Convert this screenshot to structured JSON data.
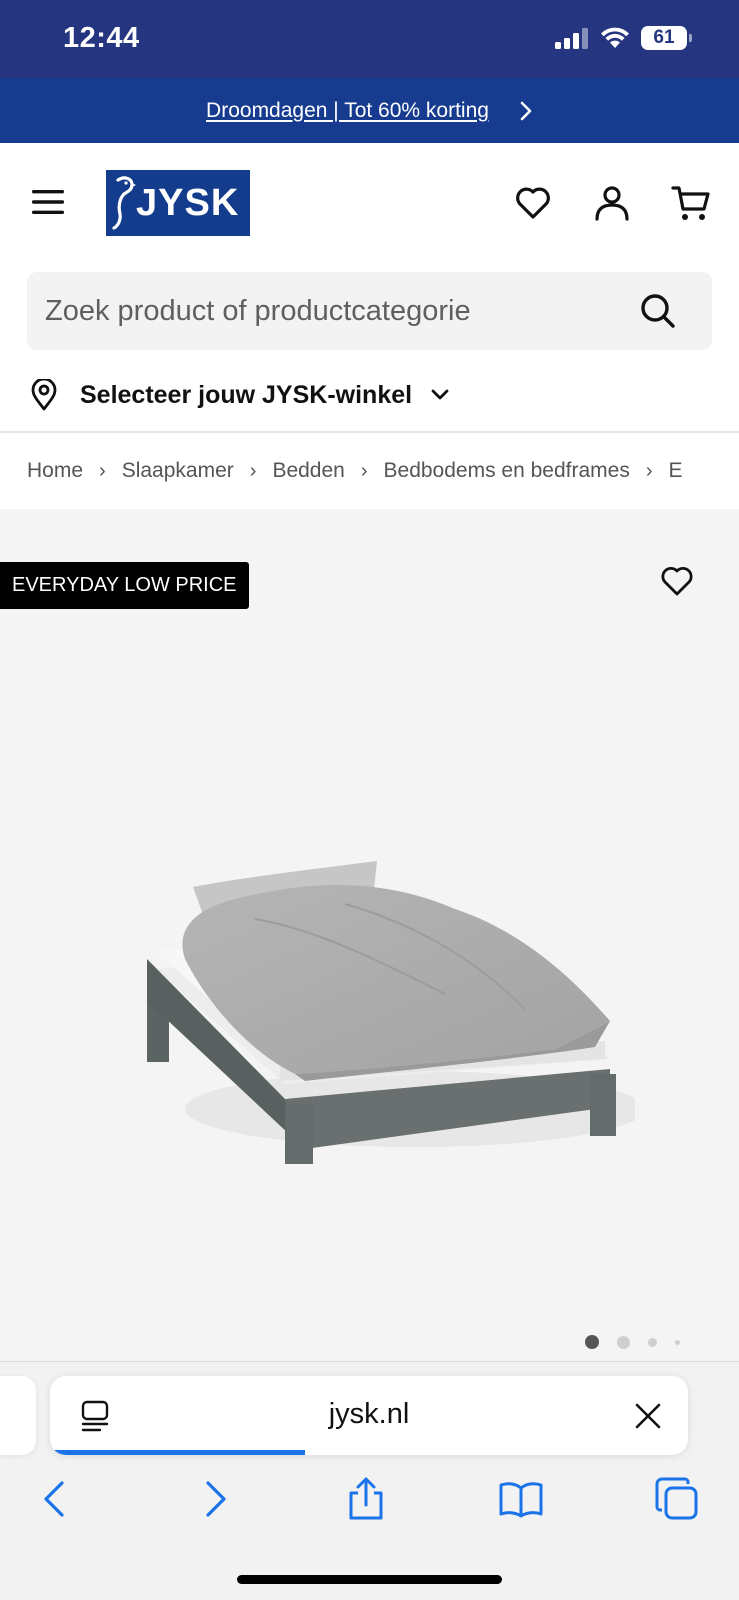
{
  "status_bar": {
    "time": "12:44",
    "battery": "61"
  },
  "promo": {
    "text": "Droomdagen | Tot 60% korting"
  },
  "header": {
    "logo_text": "JYSK"
  },
  "search": {
    "placeholder": "Zoek product of productcategorie"
  },
  "store": {
    "label": "Selecteer jouw JYSK-winkel"
  },
  "breadcrumb": {
    "items": [
      "Home",
      "Slaapkamer",
      "Bedden",
      "Bedbodems en bedframes",
      "E"
    ],
    "separator": "›"
  },
  "product": {
    "badge": "EVERYDAY LOW PRICE",
    "image_count": 4,
    "active_image": 1
  },
  "browser": {
    "url": "jysk.nl",
    "load_progress": 0.4
  },
  "colors": {
    "status_bar": "#25357f",
    "promo_bar": "#173b8f",
    "brand_blue": "#143c8c",
    "safari_blue": "#1a73e8"
  }
}
